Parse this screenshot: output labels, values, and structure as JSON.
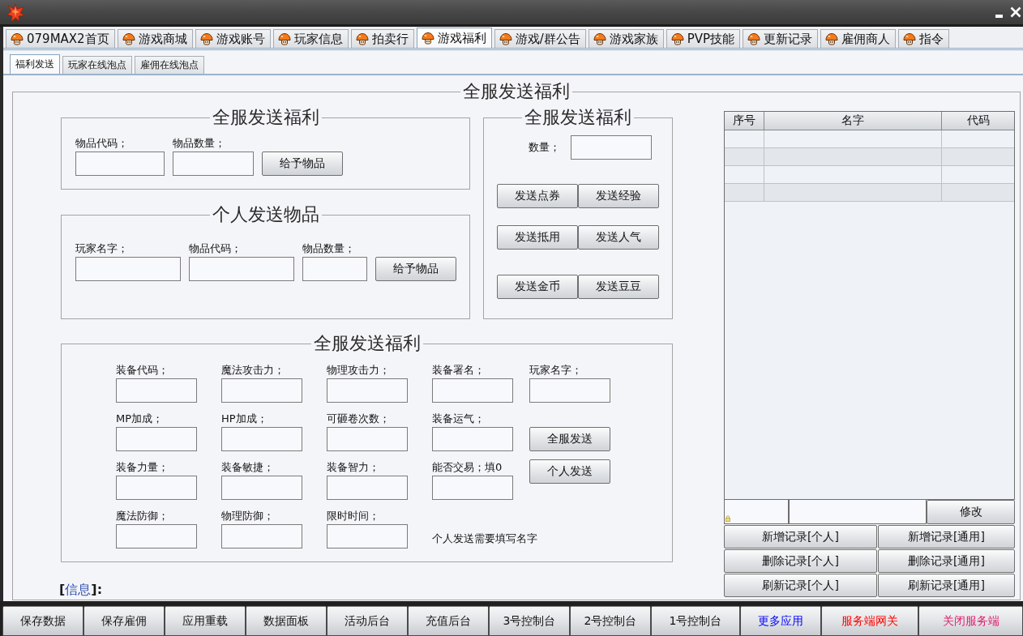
{
  "tabs": [
    {
      "label": "079MAX2首页",
      "selected": false
    },
    {
      "label": "游戏商城",
      "selected": false
    },
    {
      "label": "游戏账号",
      "selected": false
    },
    {
      "label": "玩家信息",
      "selected": false
    },
    {
      "label": "拍卖行",
      "selected": false
    },
    {
      "label": "游戏福利",
      "selected": true
    },
    {
      "label": "游戏/群公告",
      "selected": false
    },
    {
      "label": "游戏家族",
      "selected": false
    },
    {
      "label": "PVP技能",
      "selected": false
    },
    {
      "label": "更新记录",
      "selected": false
    },
    {
      "label": "雇佣商人",
      "selected": false
    },
    {
      "label": "指令",
      "selected": false
    }
  ],
  "sub_tabs": [
    {
      "label": "福利发送",
      "selected": true
    },
    {
      "label": "玩家在线泡点",
      "selected": false
    },
    {
      "label": "雇佣在线泡点",
      "selected": false
    }
  ],
  "welfare": {
    "title": "全服发送福利",
    "item_group": {
      "title": "全服发送福利",
      "fields": [
        {
          "label": "物品代码；"
        },
        {
          "label": "物品数量；"
        }
      ],
      "button": "给予物品"
    },
    "personal_group": {
      "title": "个人发送物品",
      "fields": [
        {
          "label": "玩家名字；"
        },
        {
          "label": "物品代码；"
        },
        {
          "label": "物品数量；"
        }
      ],
      "button": "给予物品"
    },
    "currency_group": {
      "title": "全服发送福利",
      "amount_label": "数量；",
      "button_rows": [
        [
          "发送点券",
          "发送经验"
        ],
        [
          "发送抵用",
          "发送人气"
        ],
        [
          "发送金币",
          "发送豆豆"
        ]
      ]
    },
    "equipment_group": {
      "title": "全服发送福利",
      "fields": [
        {
          "label": "装备代码；"
        },
        {
          "label": "魔法攻击力；"
        },
        {
          "label": "物理攻击力；"
        },
        {
          "label": "装备署名；"
        },
        {
          "label": "MP加成；"
        },
        {
          "label": "HP加成；"
        },
        {
          "label": "可砸卷次数；"
        },
        {
          "label": "装备运气；"
        },
        {
          "label": "装备力量；"
        },
        {
          "label": "装备敏捷；"
        },
        {
          "label": "装备智力；"
        },
        {
          "label": "能否交易；填0"
        },
        {
          "label": "魔法防御；"
        },
        {
          "label": "物理防御；"
        },
        {
          "label": "限时时间；"
        }
      ],
      "note": "个人发送需要填写名字",
      "player_field": {
        "label": "玩家名字；"
      },
      "buttons": [
        "全服发送",
        "个人发送"
      ]
    },
    "info": {
      "open": "[",
      "label": "信息",
      "close": "]:"
    }
  },
  "records": {
    "columns": [
      "序号",
      "名字",
      "代码"
    ],
    "edit_button": "修改",
    "button_rows": [
      [
        "新增记录[个人]",
        "新增记录[通用]"
      ],
      [
        "删除记录[个人]",
        "删除记录[通用]"
      ],
      [
        "刷新记录[个人]",
        "刷新记录[通用]"
      ]
    ]
  },
  "bottom_bar": [
    {
      "label": "保存数据"
    },
    {
      "label": "保存雇佣"
    },
    {
      "label": "应用重载"
    },
    {
      "label": "数据面板"
    },
    {
      "label": "活动后台"
    },
    {
      "label": "充值后台"
    },
    {
      "label": "3号控制台"
    },
    {
      "label": "2号控制台"
    },
    {
      "label": "1号控制台"
    },
    {
      "label": "更多应用",
      "color": "#0000ff"
    },
    {
      "label": "服务端网关",
      "color": "#ff0000"
    },
    {
      "label": "关闭服务端",
      "color": "#e0206e"
    }
  ]
}
